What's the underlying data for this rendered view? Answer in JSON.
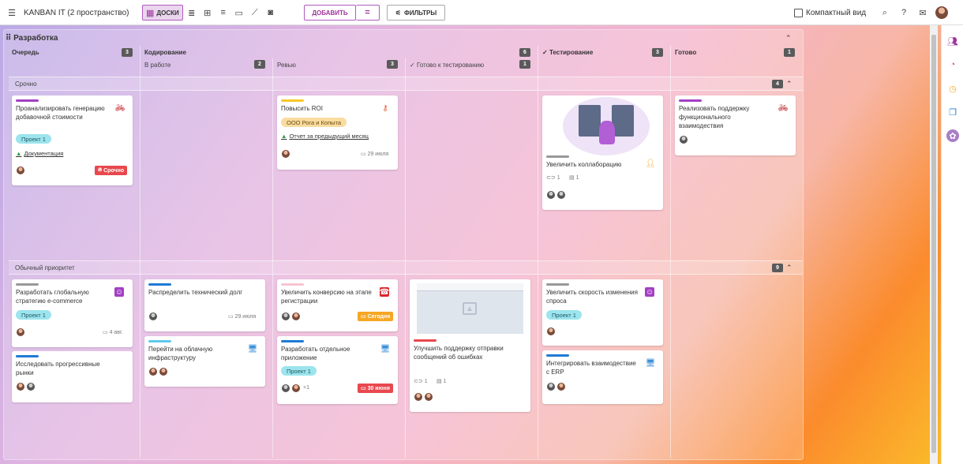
{
  "app": {
    "title": "KANBAN IT (2 пространство)"
  },
  "toolbar": {
    "boards": "ДОСКИ",
    "add": "ДОБАВИТЬ",
    "filters": "ФИЛЬТРЫ",
    "compact": "Компактный вид"
  },
  "board": {
    "title": "Разработка"
  },
  "columns": {
    "queue": "Очередь",
    "queue_count": "3",
    "coding": "Кодирование",
    "inwork": "В работе",
    "inwork_count": "2",
    "review": "Ревью",
    "review_count": "3",
    "ready_test": "Готово к тестированию",
    "ready_test_count": "1",
    "coding_count": "6",
    "testing": "Тестирование",
    "testing_count": "3",
    "done": "Готово",
    "done_count": "1"
  },
  "lanes": {
    "urgent": "Срочно",
    "urgent_count": "4",
    "normal": "Обычный приоритет",
    "normal_count": "9"
  },
  "cards": {
    "c1": {
      "title": "Проанализировать генерацию добавочной стоимости",
      "tag": "Проект 1",
      "link": "Документация",
      "badge": "Срочно"
    },
    "c2": {
      "title": "Повысить ROI",
      "tag": "ООО Рога и Копыта",
      "link": "Отчет за предыдущий месяц",
      "date": "29 июля"
    },
    "c3": {
      "title": "Увеличить коллаборацию",
      "attach": "1",
      "comments": "1"
    },
    "c4": {
      "title": "Реализовать поддержку функционального взаимодествия"
    },
    "c5": {
      "title": "Разработать глобальную стратегию e-commerce",
      "tag": "Проект 1",
      "date": "4 авг."
    },
    "c6": {
      "title": "Исследовать прогрессивные рынки"
    },
    "c7": {
      "title": "Распределить технический долг",
      "date": "29 июля"
    },
    "c8": {
      "title": "Перейти на облачную инфраструктуру"
    },
    "c9": {
      "title": "Увеличить конверсию на этапе регистрации",
      "badge": "Сегодня"
    },
    "c10": {
      "title": "Разработать отдельное приложение",
      "tag": "Проект 1",
      "more": "+1",
      "badge": "30 июня"
    },
    "c11": {
      "title": "Улучшить поддержку отправки сообщений об ошибках",
      "attach": "1",
      "comments": "1"
    },
    "c12": {
      "title": "Увеличить скорость изменения спроса",
      "tag": "Проект 1"
    },
    "c13": {
      "title": "Интегрировать взаимодествие с ERP"
    }
  },
  "colors": {
    "accent": "#a0349c",
    "urgent": "#e8484e",
    "today": "#f6a623",
    "tag": "#9ce4ee"
  }
}
